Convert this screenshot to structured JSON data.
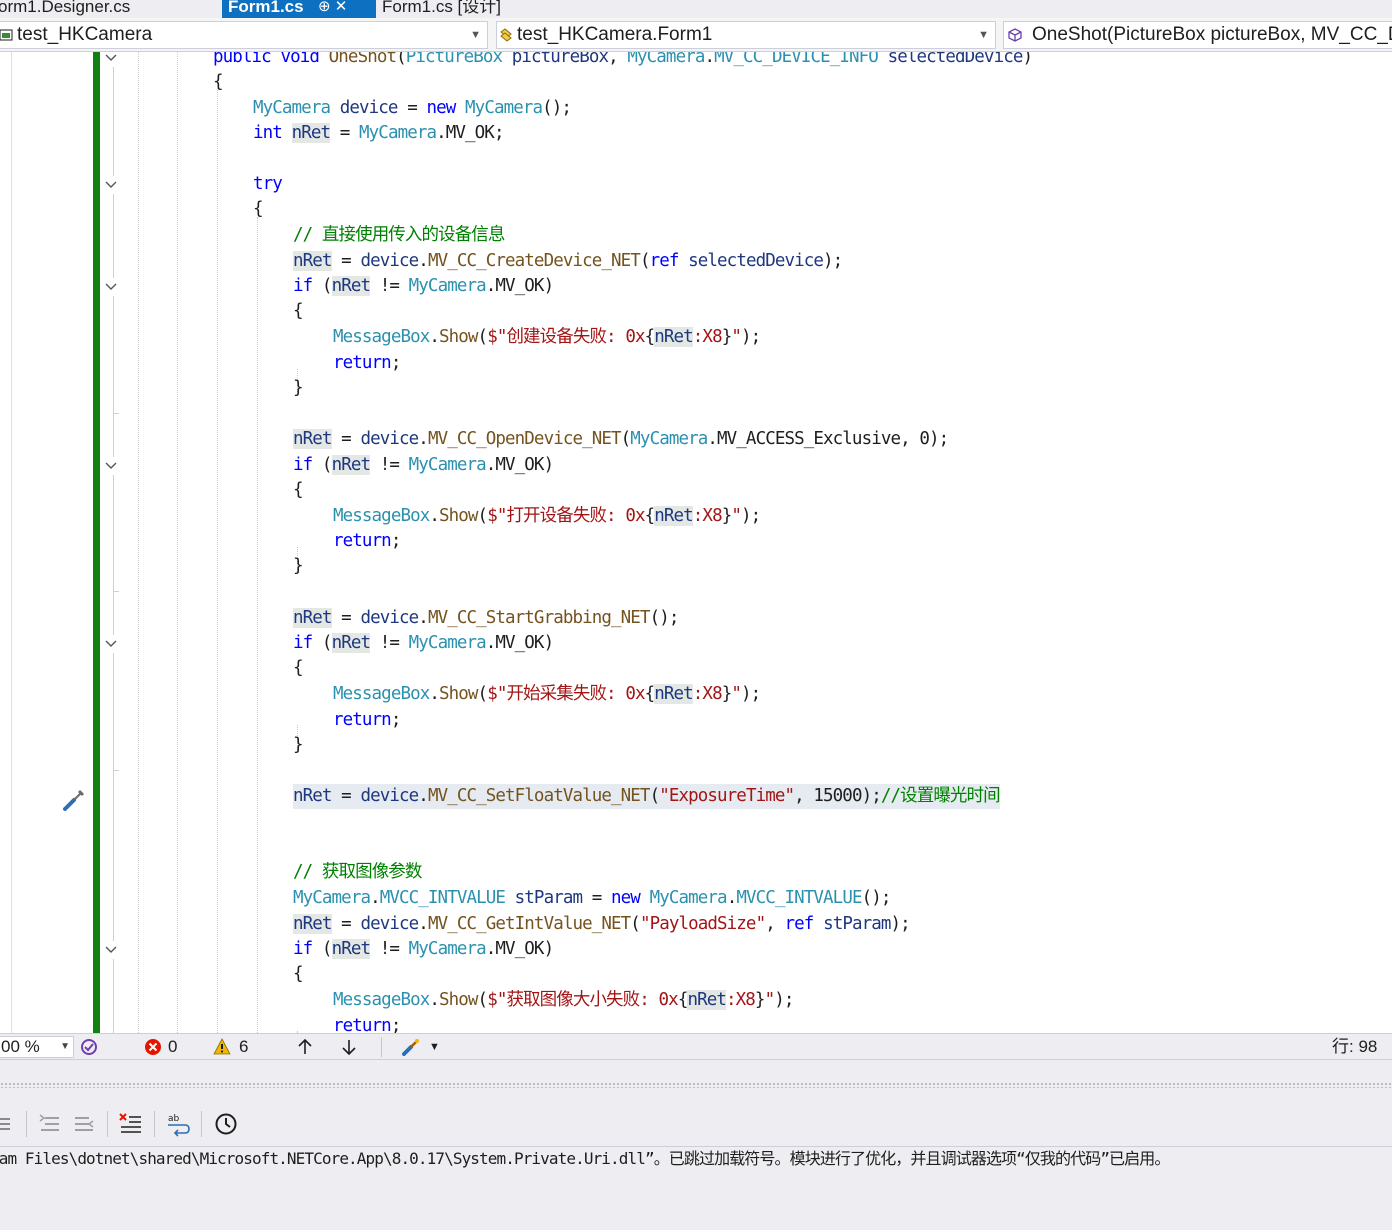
{
  "tabs": {
    "designer": "orm1.Designer.cs",
    "active": "Form1.cs",
    "active_controls": "⊕ ✕",
    "design_view": "Form1.cs [设计]"
  },
  "nav": {
    "project": "test_HKCamera",
    "class": "test_HKCamera.Form1",
    "member": "OneShot(PictureBox pictureBox, MV_CC_D"
  },
  "code_lines": [
    [
      [
        "kw",
        "public"
      ],
      [
        "pu",
        " "
      ],
      [
        "kw",
        "void"
      ],
      [
        "pu",
        " "
      ],
      [
        "me",
        "OneShot"
      ],
      [
        "pu",
        "("
      ],
      [
        "ty",
        "PictureBox"
      ],
      [
        "pu",
        " "
      ],
      [
        "va",
        "pictureBox"
      ],
      [
        "pu",
        ", "
      ],
      [
        "ty",
        "MyCamera"
      ],
      [
        "pu",
        "."
      ],
      [
        "ty",
        "MV_CC_DEVICE_INFO"
      ],
      [
        "pu",
        " "
      ],
      [
        "va",
        "selectedDevice"
      ],
      [
        "pu",
        ")"
      ]
    ],
    [
      [
        "pu",
        "{"
      ]
    ],
    [
      [
        "ty",
        "MyCamera"
      ],
      [
        "pu",
        " "
      ],
      [
        "va",
        "device"
      ],
      [
        "pu",
        " = "
      ],
      [
        "kw",
        "new"
      ],
      [
        "pu",
        " "
      ],
      [
        "ty",
        "MyCamera"
      ],
      [
        "pu",
        "();"
      ]
    ],
    [
      [
        "kw",
        "int"
      ],
      [
        "pu",
        " "
      ],
      [
        "va hl",
        "nRet"
      ],
      [
        "pu",
        " = "
      ],
      [
        "ty",
        "MyCamera"
      ],
      [
        "pu",
        ".MV_OK;"
      ]
    ],
    [
      [
        "kw",
        "try"
      ]
    ],
    [
      [
        "pu",
        "{"
      ]
    ],
    [
      [
        "cm",
        "// 直接使用传入的设备信息"
      ]
    ],
    [
      [
        "va hl",
        "nRet"
      ],
      [
        "pu",
        " = "
      ],
      [
        "va",
        "device"
      ],
      [
        "pu",
        "."
      ],
      [
        "me",
        "MV_CC_CreateDevice_NET"
      ],
      [
        "pu",
        "("
      ],
      [
        "kw",
        "ref"
      ],
      [
        "pu",
        " "
      ],
      [
        "va",
        "selectedDevice"
      ],
      [
        "pu",
        ");"
      ]
    ],
    [
      [
        "kw",
        "if"
      ],
      [
        "pu",
        " ("
      ],
      [
        "va hl",
        "nRet"
      ],
      [
        "pu",
        " != "
      ],
      [
        "ty",
        "MyCamera"
      ],
      [
        "pu",
        ".MV_OK)"
      ]
    ],
    [
      [
        "pu",
        "{"
      ]
    ],
    [
      [
        "ty",
        "MessageBox"
      ],
      [
        "pu",
        "."
      ],
      [
        "me",
        "Show"
      ],
      [
        "pu",
        "("
      ],
      [
        "st",
        "$\"创建设备失败: 0x"
      ],
      [
        "pu",
        "{"
      ],
      [
        "va hl",
        "nRet"
      ],
      [
        "st",
        ":X8"
      ],
      [
        "pu",
        "}"
      ],
      [
        "st",
        "\""
      ],
      [
        "pu",
        ");"
      ]
    ],
    [
      [
        "kw",
        "return"
      ],
      [
        "pu",
        ";"
      ]
    ],
    [
      [
        "pu",
        "}"
      ]
    ],
    [
      [
        "va hl",
        "nRet"
      ],
      [
        "pu",
        " = "
      ],
      [
        "va",
        "device"
      ],
      [
        "pu",
        "."
      ],
      [
        "me",
        "MV_CC_OpenDevice_NET"
      ],
      [
        "pu",
        "("
      ],
      [
        "ty",
        "MyCamera"
      ],
      [
        "pu",
        ".MV_ACCESS_Exclusive, 0);"
      ]
    ],
    [
      [
        "kw",
        "if"
      ],
      [
        "pu",
        " ("
      ],
      [
        "va hl",
        "nRet"
      ],
      [
        "pu",
        " != "
      ],
      [
        "ty",
        "MyCamera"
      ],
      [
        "pu",
        ".MV_OK)"
      ]
    ],
    [
      [
        "pu",
        "{"
      ]
    ],
    [
      [
        "ty",
        "MessageBox"
      ],
      [
        "pu",
        "."
      ],
      [
        "me",
        "Show"
      ],
      [
        "pu",
        "("
      ],
      [
        "st",
        "$\"打开设备失败: 0x"
      ],
      [
        "pu",
        "{"
      ],
      [
        "va hl",
        "nRet"
      ],
      [
        "st",
        ":X8"
      ],
      [
        "pu",
        "}"
      ],
      [
        "st",
        "\""
      ],
      [
        "pu",
        ");"
      ]
    ],
    [
      [
        "kw",
        "return"
      ],
      [
        "pu",
        ";"
      ]
    ],
    [
      [
        "pu",
        "}"
      ]
    ],
    [
      [
        "va hl",
        "nRet"
      ],
      [
        "pu",
        " = "
      ],
      [
        "va",
        "device"
      ],
      [
        "pu",
        "."
      ],
      [
        "me",
        "MV_CC_StartGrabbing_NET"
      ],
      [
        "pu",
        "();"
      ]
    ],
    [
      [
        "kw",
        "if"
      ],
      [
        "pu",
        " ("
      ],
      [
        "va hl",
        "nRet"
      ],
      [
        "pu",
        " != "
      ],
      [
        "ty",
        "MyCamera"
      ],
      [
        "pu",
        ".MV_OK)"
      ]
    ],
    [
      [
        "pu",
        "{"
      ]
    ],
    [
      [
        "ty",
        "MessageBox"
      ],
      [
        "pu",
        "."
      ],
      [
        "me",
        "Show"
      ],
      [
        "pu",
        "("
      ],
      [
        "st",
        "$\"开始采集失败: 0x"
      ],
      [
        "pu",
        "{"
      ],
      [
        "va hl",
        "nRet"
      ],
      [
        "st",
        ":X8"
      ],
      [
        "pu",
        "}"
      ],
      [
        "st",
        "\""
      ],
      [
        "pu",
        ");"
      ]
    ],
    [
      [
        "kw",
        "return"
      ],
      [
        "pu",
        ";"
      ]
    ],
    [
      [
        "pu",
        "}"
      ]
    ],
    [
      [
        "va",
        "nRet"
      ],
      [
        "pu",
        " = "
      ],
      [
        "va",
        "device"
      ],
      [
        "pu",
        "."
      ],
      [
        "me",
        "MV_CC_SetFloatValue_NET"
      ],
      [
        "pu",
        "("
      ],
      [
        "st",
        "\"ExposureTime\""
      ],
      [
        "pu",
        ", 15000);"
      ],
      [
        "cm",
        "//设置曝光时间"
      ]
    ],
    [
      [
        "cm",
        "// 获取图像参数"
      ]
    ],
    [
      [
        "ty",
        "MyCamera"
      ],
      [
        "pu",
        "."
      ],
      [
        "ty",
        "MVCC_INTVALUE"
      ],
      [
        "pu",
        " "
      ],
      [
        "va",
        "stParam"
      ],
      [
        "pu",
        " = "
      ],
      [
        "kw",
        "new"
      ],
      [
        "pu",
        " "
      ],
      [
        "ty",
        "MyCamera"
      ],
      [
        "pu",
        "."
      ],
      [
        "ty",
        "MVCC_INTVALUE"
      ],
      [
        "pu",
        "();"
      ]
    ],
    [
      [
        "va hl",
        "nRet"
      ],
      [
        "pu",
        " = "
      ],
      [
        "va",
        "device"
      ],
      [
        "pu",
        "."
      ],
      [
        "me",
        "MV_CC_GetIntValue_NET"
      ],
      [
        "pu",
        "("
      ],
      [
        "st",
        "\"PayloadSize\""
      ],
      [
        "pu",
        ", "
      ],
      [
        "kw",
        "ref"
      ],
      [
        "pu",
        " "
      ],
      [
        "va",
        "stParam"
      ],
      [
        "pu",
        ");"
      ]
    ],
    [
      [
        "kw",
        "if"
      ],
      [
        "pu",
        " ("
      ],
      [
        "va hl",
        "nRet"
      ],
      [
        "pu",
        " != "
      ],
      [
        "ty",
        "MyCamera"
      ],
      [
        "pu",
        ".MV_OK)"
      ]
    ],
    [
      [
        "pu",
        "{"
      ]
    ],
    [
      [
        "ty",
        "MessageBox"
      ],
      [
        "pu",
        "."
      ],
      [
        "me",
        "Show"
      ],
      [
        "pu",
        "("
      ],
      [
        "st",
        "$\"获取图像大小失败: 0x"
      ],
      [
        "pu",
        "{"
      ],
      [
        "va hl",
        "nRet"
      ],
      [
        "st",
        ":X8"
      ],
      [
        "pu",
        "}"
      ],
      [
        "st",
        "\""
      ],
      [
        "pu",
        ");"
      ]
    ],
    [
      [
        "kw",
        "return"
      ],
      [
        "pu",
        ";"
      ]
    ]
  ],
  "status": {
    "zoom": "00 %",
    "errors": "0",
    "warnings": "6",
    "line": "行: 98"
  },
  "output": {
    "text": "ram Files\\dotnet\\shared\\Microsoft.NETCore.App\\8.0.17\\System.Private.Uri.dll”。已跳过加载符号。模块进行了优化，并且调试器选项“仅我的代码”已启用。"
  },
  "icons": {
    "quick_action": "screwdriver-icon",
    "errors": "error-icon",
    "warnings": "warning-icon",
    "prev": "arrow-up-icon",
    "next": "arrow-down-icon",
    "cleanup": "brush-icon",
    "history": "clock-icon"
  },
  "colors": {
    "change_bar": "#108010",
    "active_tab": "#0e70c0",
    "keyword": "#0000ff",
    "type": "#2b91af",
    "string": "#a31515",
    "comment": "#008000"
  }
}
